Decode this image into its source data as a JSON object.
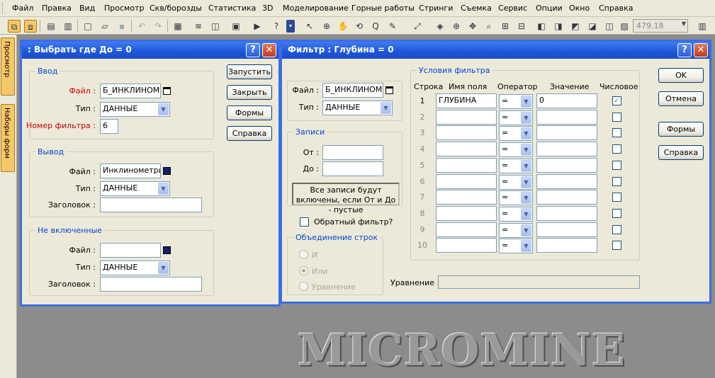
{
  "menu": [
    "Файл",
    "Правка",
    "Вид",
    "Просмотр",
    "Скв/борозды",
    "Статистика",
    "3D",
    "Моделирование",
    "Горные работы",
    "Стринги",
    "Съемка",
    "Сервис",
    "Опции",
    "Окно",
    "Справка"
  ],
  "toolbar": {
    "zoom_value": "479.18"
  },
  "side_tabs": [
    "Просмотр",
    "Наборы форм"
  ],
  "logo": "MICROMINE",
  "dialog1": {
    "title": ": Выбрать где До = 0",
    "input": {
      "title": "Ввод",
      "file_label": "Файл :",
      "file_value": "Б_ИНКЛИНОМ",
      "type_label": "Тип :",
      "type_value": "ДАННЫЕ",
      "filter_label": "Номер фильтра :",
      "filter_value": "6"
    },
    "output": {
      "title": "Вывод",
      "file_label": "Файл :",
      "file_value": "Инклинометри",
      "type_label": "Тип :",
      "type_value": "ДАННЫЕ",
      "header_label": "Заголовок :",
      "header_value": ""
    },
    "excluded": {
      "title": "Не включенные",
      "file_label": "Файл :",
      "file_value": "",
      "type_label": "Тип :",
      "type_value": "ДАННЫЕ",
      "header_label": "Заголовок :",
      "header_value": ""
    },
    "buttons": {
      "run": "Запустить",
      "close": "Закрыть",
      "forms": "Формы",
      "help": "Справка"
    }
  },
  "dialog2": {
    "title": "Фильтр : Глубина = 0",
    "file_label": "Файл :",
    "file_value": "Б_ИНКЛИНОМ",
    "type_label": "Тип :",
    "type_value": "ДАННЫЕ",
    "records": {
      "title": "Записи",
      "from_label": "От :",
      "to_label": "До :",
      "note": "Все записи будут включены, если От и До - пустые"
    },
    "reverse_label": "Обратный фильтр?",
    "join": {
      "title": "Объединение строк",
      "options": [
        "И",
        "Или",
        "Уравнение"
      ],
      "selected": "Или"
    },
    "conditions": {
      "title": "Условия фильтра",
      "headers": [
        "Строка",
        "Имя поля",
        "Оператор",
        "Значение",
        "Числовое"
      ],
      "rows": [
        {
          "n": "1",
          "field": "ГЛУБИНА",
          "op": "=",
          "value": "0",
          "numeric": true
        },
        {
          "n": "2",
          "field": "",
          "op": "=",
          "value": "",
          "numeric": false
        },
        {
          "n": "3",
          "field": "",
          "op": "=",
          "value": "",
          "numeric": false
        },
        {
          "n": "4",
          "field": "",
          "op": "=",
          "value": "",
          "numeric": false
        },
        {
          "n": "5",
          "field": "",
          "op": "=",
          "value": "",
          "numeric": false
        },
        {
          "n": "6",
          "field": "",
          "op": "=",
          "value": "",
          "numeric": false
        },
        {
          "n": "7",
          "field": "",
          "op": "=",
          "value": "",
          "numeric": false
        },
        {
          "n": "8",
          "field": "",
          "op": "=",
          "value": "",
          "numeric": false
        },
        {
          "n": "9",
          "field": "",
          "op": "=",
          "value": "",
          "numeric": false
        },
        {
          "n": "10",
          "field": "",
          "op": "=",
          "value": "",
          "numeric": false
        }
      ]
    },
    "equation_label": "Уравнение :",
    "buttons": {
      "ok": "OK",
      "cancel": "Отмена",
      "forms": "Формы",
      "help": "Справка"
    }
  }
}
